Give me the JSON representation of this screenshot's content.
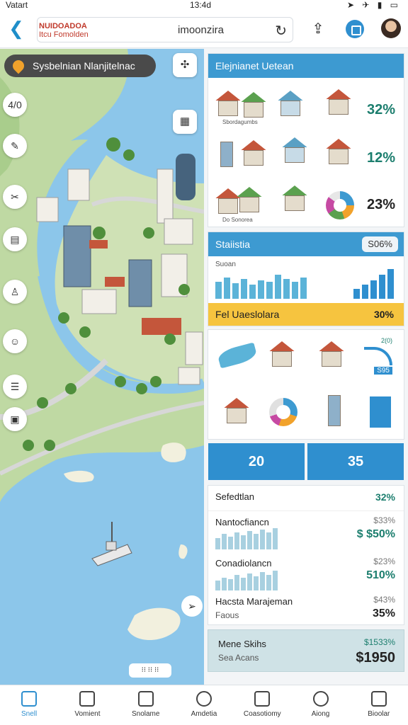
{
  "status_bar": {
    "carrier": "Vatart",
    "time": "13:4d",
    "icons": "➤ ✈ ▮ ▭"
  },
  "header": {
    "brand_line1": "NUIDOADOA",
    "brand_line2": "Itcu  Fomolden",
    "url": "imoonzira",
    "back_icon": "back-chevron-icon",
    "reload_icon": "reload-icon",
    "share_icon": "share-icon"
  },
  "map": {
    "title": "Sysbelnian Nlanjitelnac",
    "tool_labels": [
      "4/0",
      "",
      "",
      "",
      "",
      "",
      "",
      ""
    ],
    "bottom_control": "⁝⁝ ⁝⁝ ⁝⁝"
  },
  "panel": {
    "top_card": {
      "title": "Elejnianet Uetean",
      "caption": "Sbordagumbs",
      "caption2": "Do Sonorea",
      "pct1": "32%",
      "pct2": "12%",
      "pct3": "23%"
    },
    "stats_card": {
      "title": "Staiistia",
      "pill": "S06%",
      "caption": "Suoan",
      "strip_label": "Fel Uaeslolara",
      "strip_value": "30%"
    },
    "icons_card": {
      "chart_label": "2(0)",
      "badge": "S95"
    },
    "tiles": [
      "20",
      "35"
    ],
    "stat_rows": [
      {
        "label": "Sefedtlan",
        "pct": "32%"
      },
      {
        "label": "Nantocfiancn",
        "pct_small": "$33%",
        "pct_big": "$ $50%"
      },
      {
        "label": "Conadiolancn",
        "pct_small": "$23%",
        "pct_big": "510%"
      },
      {
        "label": "Hacsta Marajeman",
        "sub": "Faous",
        "pct_small": "$43%",
        "pct_big": "35%"
      }
    ],
    "mene": {
      "label": "Mene Skihs",
      "sub": "Sea Acans",
      "pct": "$1533%",
      "price": "$1950"
    }
  },
  "bottom_nav": [
    {
      "label": "Snell",
      "active": true
    },
    {
      "label": "Vomient",
      "active": false
    },
    {
      "label": "Snolame",
      "active": false
    },
    {
      "label": "Amdetia",
      "active": false
    },
    {
      "label": "Coasotiomy",
      "active": false
    },
    {
      "label": "Aiong",
      "active": false
    },
    {
      "label": "Bioolar",
      "active": false
    }
  ],
  "colors": {
    "accent": "#2f8fcf",
    "water": "#8cc6ea",
    "green_text": "#1c7e6e",
    "yellow": "#f6c43f"
  }
}
